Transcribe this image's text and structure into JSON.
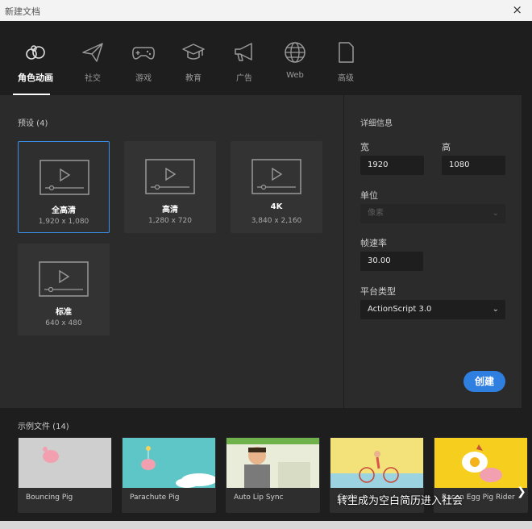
{
  "window": {
    "title": "新建文档",
    "close_icon": "×"
  },
  "categories": [
    {
      "label": "角色动画",
      "icon": "character-animation-icon"
    },
    {
      "label": "社交",
      "icon": "paper-plane-icon"
    },
    {
      "label": "游戏",
      "icon": "gamepad-icon"
    },
    {
      "label": "教育",
      "icon": "graduation-cap-icon"
    },
    {
      "label": "广告",
      "icon": "megaphone-icon"
    },
    {
      "label": "Web",
      "icon": "globe-icon"
    },
    {
      "label": "高级",
      "icon": "document-icon"
    }
  ],
  "presets": {
    "heading": "预设 (4)",
    "items": [
      {
        "name": "全高清",
        "dims": "1,920 x 1,080"
      },
      {
        "name": "高清",
        "dims": "1,280 x 720"
      },
      {
        "name": "4K",
        "dims": "3,840 x 2,160"
      },
      {
        "name": "标准",
        "dims": "640 x 480"
      }
    ]
  },
  "details": {
    "heading": "详细信息",
    "width_label": "宽",
    "width_value": "1920",
    "height_label": "高",
    "height_value": "1080",
    "unit_label": "单位",
    "unit_value": "像素",
    "fps_label": "帧速率",
    "fps_value": "30.00",
    "platform_label": "平台类型",
    "platform_value": "ActionScript 3.0",
    "create_label": "创建"
  },
  "samples": {
    "heading": "示例文件 (14)",
    "items": [
      {
        "label": "Bouncing Pig"
      },
      {
        "label": "Parachute Pig"
      },
      {
        "label": "Auto Lip Sync"
      },
      {
        "label": "Cycle"
      },
      {
        "label": "Bacon Egg Pig Rider"
      }
    ]
  },
  "watermark": "转生成为空白简历进入社会",
  "colors": {
    "accent": "#2f7fe0",
    "selected_border": "#3a8ee6"
  }
}
